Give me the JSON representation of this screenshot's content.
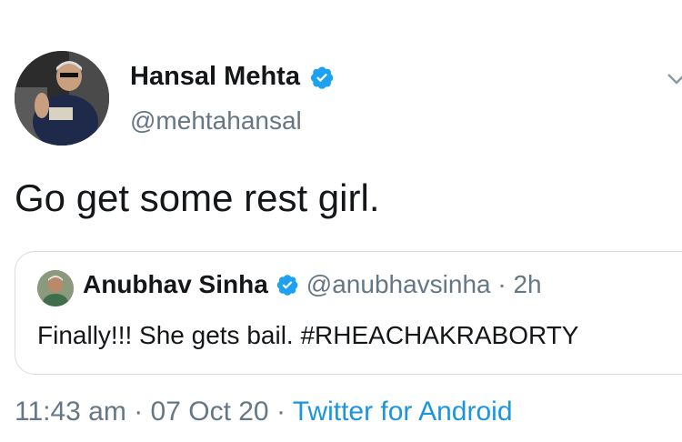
{
  "author": {
    "display_name": "Hansal Mehta",
    "handle": "@mehtahansal",
    "verified_icon": "verified-badge-icon"
  },
  "tweet": {
    "text": "Go get some rest girl."
  },
  "quoted_tweet": {
    "display_name": "Anubhav Sinha",
    "handle": "@anubhavsinha",
    "separator": " · ",
    "age": "2h",
    "text": "Finally!!! She gets bail. #RHEACHAKRABORTY"
  },
  "meta": {
    "time": "11:43 am",
    "separator": " · ",
    "date": "07 Oct 20",
    "source": "Twitter for Android"
  },
  "colors": {
    "primary_text": "#14171a",
    "secondary_text": "#657786",
    "link_blue": "#1b95e0",
    "verified_blue": "#1da1f2",
    "border": "#d6dde3"
  }
}
